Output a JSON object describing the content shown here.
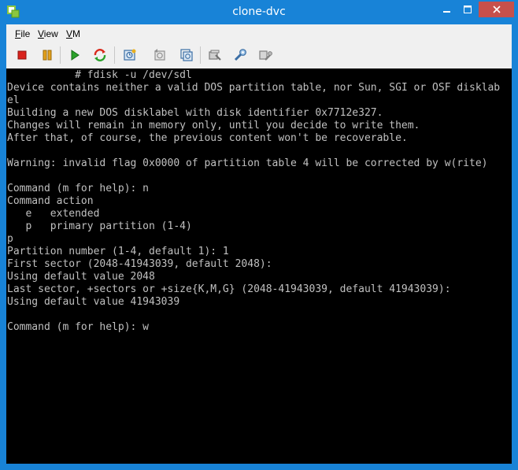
{
  "window": {
    "title": "clone-dvc",
    "icon": "vm-console-icon"
  },
  "menu": {
    "items": [
      {
        "prefix": "",
        "accel": "F",
        "rest": "ile"
      },
      {
        "prefix": "",
        "accel": "V",
        "rest": "iew"
      },
      {
        "prefix": "",
        "accel": "V",
        "rest": "M"
      }
    ]
  },
  "toolbar": {
    "buttons": [
      {
        "icon": "stop-icon",
        "color": "#d9221c"
      },
      {
        "icon": "pause-icon",
        "color": "#e4a11b"
      },
      {
        "icon": "play-icon",
        "color": "#2aa12a"
      },
      {
        "icon": "reset-icon",
        "color": "#d92a1c"
      },
      {
        "icon": "snapshot-icon"
      },
      {
        "icon": "revert-icon"
      },
      {
        "icon": "manage-snapshots-icon"
      },
      {
        "icon": "settings-icon"
      },
      {
        "icon": "tools-icon"
      },
      {
        "icon": "options-icon"
      }
    ]
  },
  "console": {
    "lines": [
      "           # fdisk -u /dev/sdl",
      "Device contains neither a valid DOS partition table, nor Sun, SGI or OSF disklab",
      "el",
      "Building a new DOS disklabel with disk identifier 0x7712e327.",
      "Changes will remain in memory only, until you decide to write them.",
      "After that, of course, the previous content won't be recoverable.",
      "",
      "Warning: invalid flag 0x0000 of partition table 4 will be corrected by w(rite)",
      "",
      "Command (m for help): n",
      "Command action",
      "   e   extended",
      "   p   primary partition (1-4)",
      "p",
      "Partition number (1-4, default 1): 1",
      "First sector (2048-41943039, default 2048):",
      "Using default value 2048",
      "Last sector, +sectors or +size{K,M,G} (2048-41943039, default 41943039):",
      "Using default value 41943039",
      "",
      "Command (m for help): w"
    ]
  }
}
